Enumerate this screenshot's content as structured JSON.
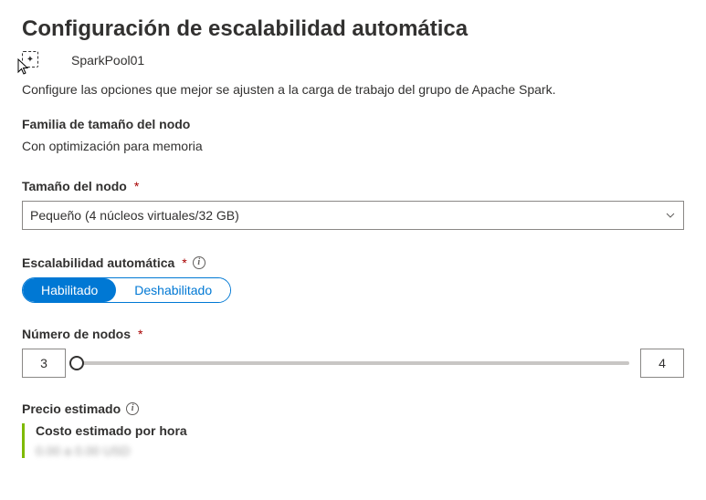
{
  "title": "Configuración de escalabilidad automática",
  "pool_name": "SparkPool01",
  "description": "Configure las opciones que mejor se ajusten a la carga de trabajo del grupo de Apache Spark.",
  "family": {
    "label": "Familia de tamaño del nodo",
    "value": "Con optimización para memoria"
  },
  "node_size": {
    "label": "Tamaño del nodo",
    "selected": "Pequeño (4 núcleos virtuales/32 GB)"
  },
  "autoscale": {
    "label": "Escalabilidad automática",
    "enabled_label": "Habilitado",
    "disabled_label": "Deshabilitado"
  },
  "node_count": {
    "label": "Número de nodos",
    "min": "3",
    "max": "4"
  },
  "price": {
    "section_label": "Precio estimado",
    "row_label": "Costo estimado por hora",
    "value": "0.00 a 0.00 USD"
  }
}
